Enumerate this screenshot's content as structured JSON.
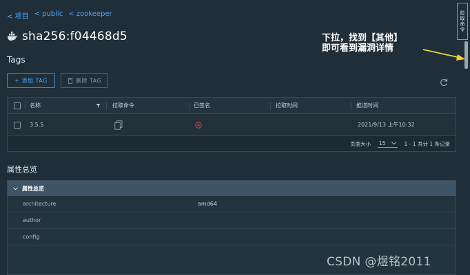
{
  "breadcrumb": [
    "< 项目",
    "< public",
    "< zookeeper"
  ],
  "page_title": "sha256:f04468d5",
  "tags_section": {
    "title": "Tags",
    "add_label": "+ 添加 TAG",
    "delete_label": "删除 TAG"
  },
  "table": {
    "headers": [
      "名称",
      "拉取命令",
      "已签名",
      "拉取时间",
      "推送时间"
    ],
    "rows": [
      {
        "name": "3.5.5",
        "pushed": "2021/9/13 上午10:32"
      }
    ],
    "footer": {
      "page_size_label": "页面大小",
      "page_size_value": "15",
      "summary": "1 - 1 共计 1 条记录"
    }
  },
  "properties": {
    "section_title": "属性总览",
    "panel_title": "属性总览",
    "rows": [
      {
        "key": "architecture",
        "value": "amd64"
      },
      {
        "key": "author",
        "value": ""
      },
      {
        "key": "config",
        "value": ""
      }
    ]
  },
  "side_tab_label": "拉取命令",
  "annotation": {
    "line1": "下拉，找到【其他】",
    "line2": "即可看到漏洞详情"
  },
  "watermark": "CSDN @煜铭2011",
  "colors": {
    "background": "#1f2e38",
    "accent": "#4aa8ff",
    "error": "#e23b3b",
    "arrow": "#f2d233"
  }
}
